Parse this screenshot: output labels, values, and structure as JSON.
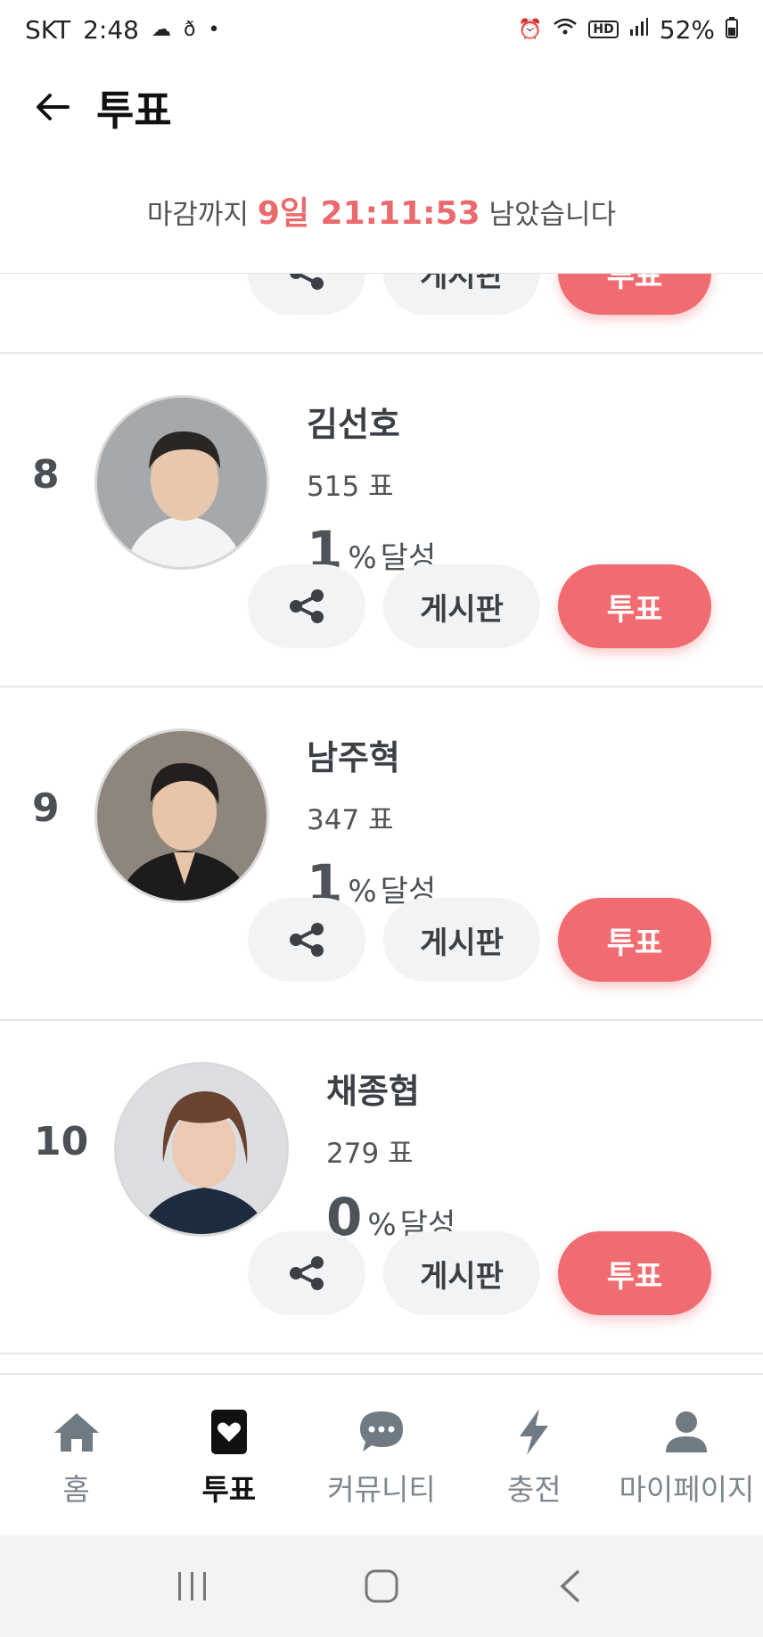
{
  "status_bar": {
    "carrier": "SKT",
    "time": "2:48",
    "battery": "52%",
    "volte": "HD"
  },
  "header": {
    "title": "투표"
  },
  "deadline": {
    "prefix": "마감까지",
    "time": "9일 21:11:53",
    "suffix": "남았습니다"
  },
  "partial_card": {
    "board_label": "게시판",
    "vote_label": "투표"
  },
  "candidates": [
    {
      "rank": "8",
      "name": "김선호",
      "votes": "515 표",
      "percent": "1",
      "percent_unit": "%",
      "percent_label": "달성",
      "board_label": "게시판",
      "vote_label": "투표",
      "share_icon": "share-icon"
    },
    {
      "rank": "9",
      "name": "남주혁",
      "votes": "347 표",
      "percent": "1",
      "percent_unit": "%",
      "percent_label": "달성",
      "board_label": "게시판",
      "vote_label": "투표",
      "share_icon": "share-icon"
    },
    {
      "rank": "10",
      "name": "채종협",
      "votes": "279 표",
      "percent": "0",
      "percent_unit": "%",
      "percent_label": "달성",
      "board_label": "게시판",
      "vote_label": "투표",
      "share_icon": "share-icon"
    }
  ],
  "bottom_nav": [
    {
      "label": "홈",
      "icon": "home-icon",
      "active": false
    },
    {
      "label": "투표",
      "icon": "vote-heart-icon",
      "active": true
    },
    {
      "label": "커뮤니티",
      "icon": "chat-bubble-icon",
      "active": false
    },
    {
      "label": "충전",
      "icon": "lightning-icon",
      "active": false
    },
    {
      "label": "마이페이지",
      "icon": "person-icon",
      "active": false
    }
  ],
  "colors": {
    "accent": "#f06c71",
    "deadline_accent": "#ea6a6e",
    "nav_inactive": "#7d868d"
  }
}
